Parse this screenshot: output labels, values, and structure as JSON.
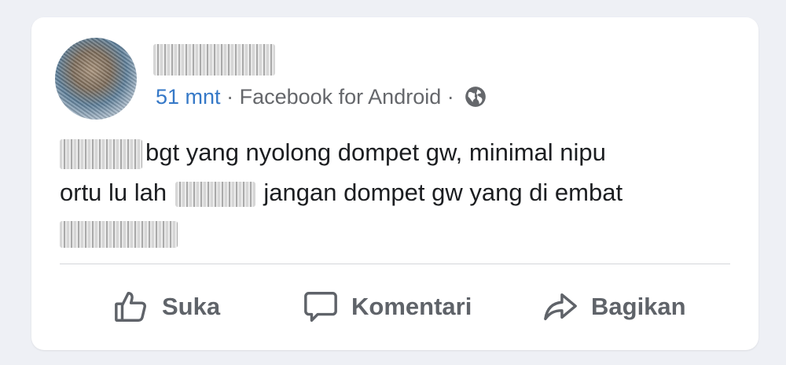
{
  "post": {
    "time": "51 mnt",
    "separator": "·",
    "source": "Facebook for Android",
    "body_line1": "bgt yang nyolong dompet gw, minimal nipu",
    "body_line2a": "ortu lu lah",
    "body_line2b": "jangan dompet gw yang di embat",
    "privacy_icon": "globe-icon"
  },
  "actions": {
    "like": "Suka",
    "comment": "Komentari",
    "share": "Bagikan"
  },
  "colors": {
    "background": "#eef0f5",
    "card": "#ffffff",
    "time_link": "#3578c7",
    "secondary_text": "#65676b",
    "body_text": "#1c1e21",
    "action_text": "#5f6369"
  }
}
